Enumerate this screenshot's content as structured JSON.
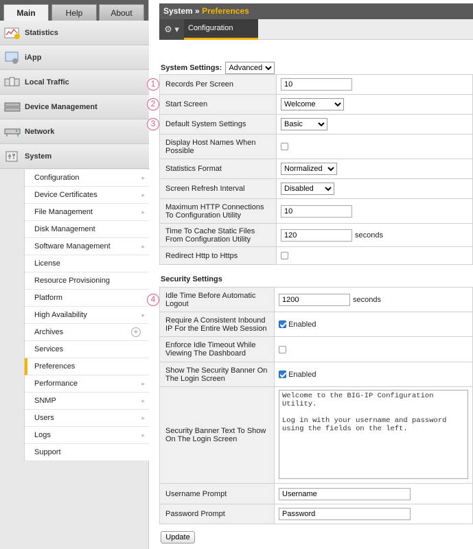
{
  "tabs": [
    "Main",
    "Help",
    "About"
  ],
  "main_nav": [
    {
      "label": "Statistics",
      "icon": "statistics-icon"
    },
    {
      "label": "iApp",
      "icon": "iapp-icon"
    },
    {
      "label": "Local Traffic",
      "icon": "local-traffic-icon"
    },
    {
      "label": "Device Management",
      "icon": "device-management-icon"
    },
    {
      "label": "Network",
      "icon": "network-icon"
    },
    {
      "label": "System",
      "icon": "system-icon"
    }
  ],
  "system_menu": [
    {
      "label": "Configuration",
      "arrow": true
    },
    {
      "label": "Device Certificates",
      "arrow": true
    },
    {
      "label": "File Management",
      "arrow": true
    },
    {
      "label": "Disk Management",
      "arrow": false
    },
    {
      "label": "Software Management",
      "arrow": true
    },
    {
      "label": "License",
      "arrow": false
    },
    {
      "label": "Resource Provisioning",
      "arrow": false
    },
    {
      "label": "Platform",
      "arrow": false
    },
    {
      "label": "High Availability",
      "arrow": true
    },
    {
      "label": "Archives",
      "arrow": false,
      "plus": true
    },
    {
      "label": "Services",
      "arrow": false
    },
    {
      "label": "Preferences",
      "arrow": false,
      "selected": true
    },
    {
      "label": "Performance",
      "arrow": true
    },
    {
      "label": "SNMP",
      "arrow": true
    },
    {
      "label": "Users",
      "arrow": true
    },
    {
      "label": "Logs",
      "arrow": true
    },
    {
      "label": "Support",
      "arrow": false
    }
  ],
  "breadcrumb": {
    "section": "System",
    "sep": "»",
    "page": "Preferences"
  },
  "toolbar": {
    "gear": "⚙ ▾",
    "tab": "Configuration"
  },
  "system_settings": {
    "title": "System Settings:",
    "mode": "Advanced",
    "rows": {
      "records_per_screen": {
        "label": "Records Per Screen",
        "value": "10",
        "callout": "1"
      },
      "start_screen": {
        "label": "Start Screen",
        "value": "Welcome",
        "callout": "2"
      },
      "default_system_settings": {
        "label": "Default System Settings",
        "value": "Basic",
        "callout": "3"
      },
      "display_host_names": {
        "label": "Display Host Names When Possible"
      },
      "statistics_format": {
        "label": "Statistics Format",
        "value": "Normalized"
      },
      "screen_refresh": {
        "label": "Screen Refresh Interval",
        "value": "Disabled"
      },
      "max_http": {
        "label": "Maximum HTTP Connections To Configuration Utility",
        "value": "10"
      },
      "cache_time": {
        "label": "Time To Cache Static Files From Configuration Utility",
        "value": "120",
        "unit": "seconds"
      },
      "redirect_https": {
        "label": "Redirect Http to Https"
      }
    }
  },
  "security_settings": {
    "title": "Security Settings",
    "rows": {
      "idle_time": {
        "label": "Idle Time Before Automatic Logout",
        "value": "1200",
        "unit": "seconds",
        "callout": "4"
      },
      "consistent_ip": {
        "label": "Require A Consistent Inbound IP For the Entire Web Session",
        "checkbox_label": "Enabled"
      },
      "enforce_idle": {
        "label": "Enforce Idle Timeout While Viewing The Dashboard"
      },
      "show_banner": {
        "label": "Show The Security Banner On The Login Screen",
        "checkbox_label": "Enabled"
      },
      "banner_text": {
        "label": "Security Banner Text To Show On The Login Screen",
        "value": "Welcome to the BIG-IP Configuration Utility.\n\nLog in with your username and password using the fields on the left."
      },
      "username_prompt": {
        "label": "Username Prompt",
        "value": "Username"
      },
      "password_prompt": {
        "label": "Password Prompt",
        "value": "Password"
      }
    }
  },
  "update_label": "Update",
  "colors": {
    "accent": "#f2b600",
    "callout": "#e05a8c",
    "checkbox": "#2b7fd6"
  }
}
